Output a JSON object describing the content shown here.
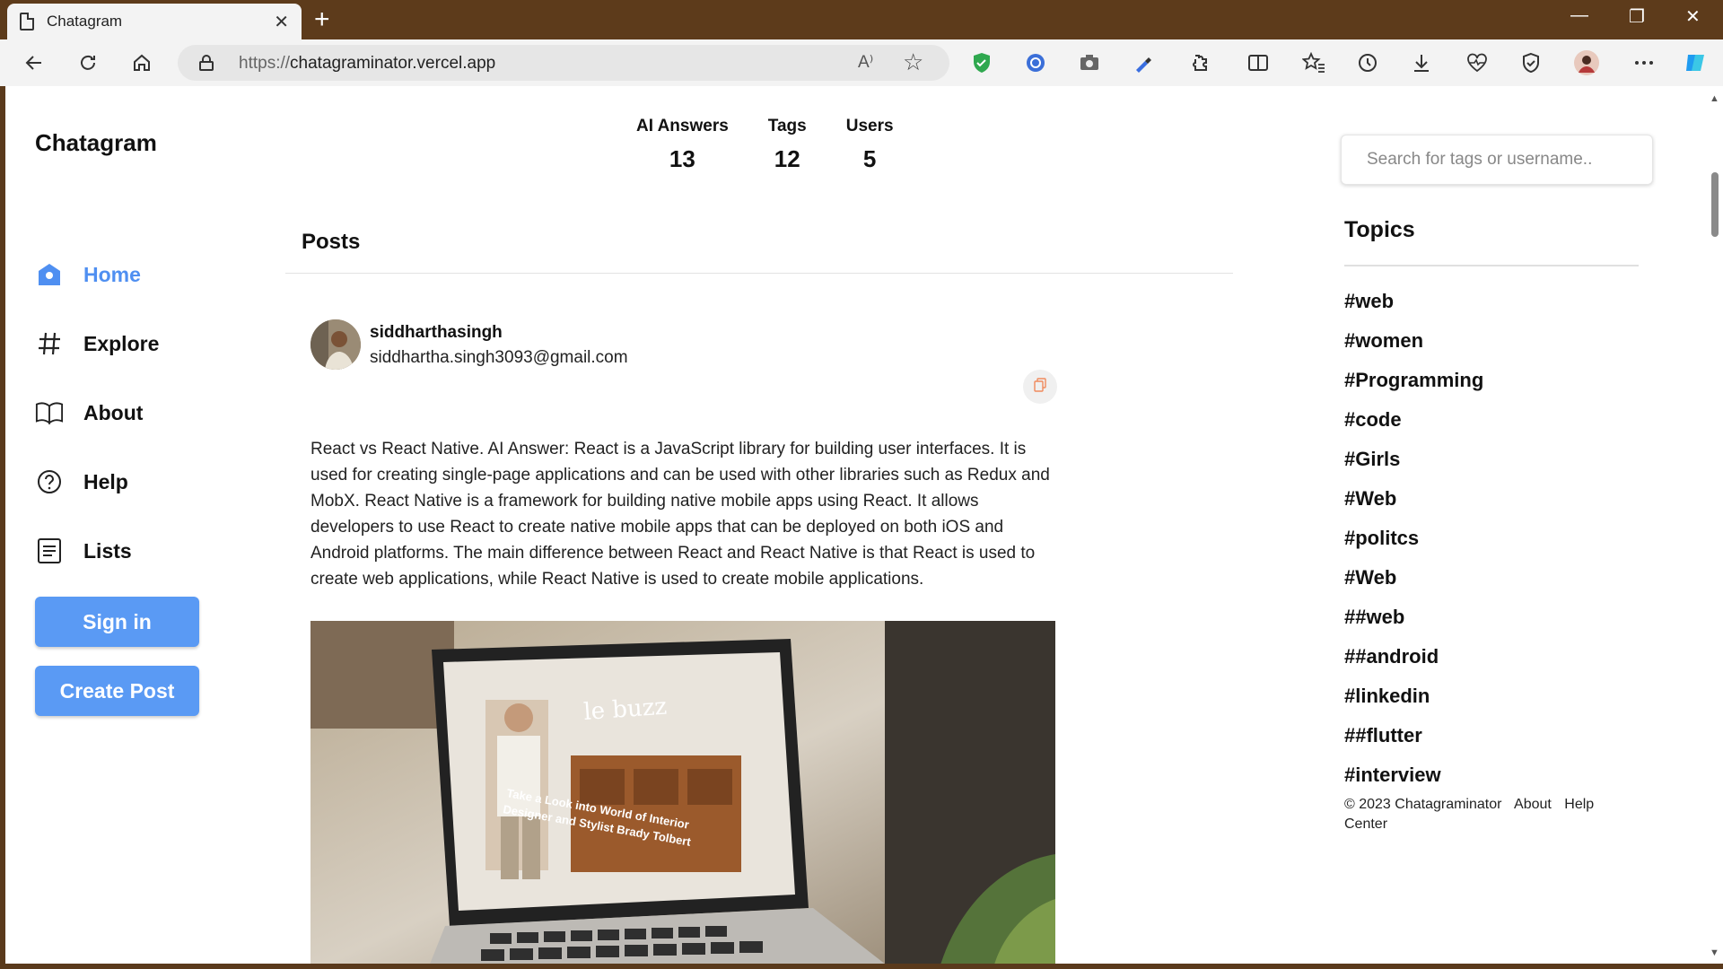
{
  "browser": {
    "tab_title": "Chatagram",
    "tab_close": "✕",
    "new_tab": "+",
    "url_protocol": "https://",
    "url_host": "chatagraminator.vercel.app",
    "read_aloud": "A⁾",
    "win_min": "—",
    "win_restore": "❐",
    "win_close": "✕"
  },
  "app": {
    "brand": "Chatagram"
  },
  "nav": [
    {
      "label": "Home",
      "icon": "home-icon",
      "active": true
    },
    {
      "label": "Explore",
      "icon": "hash-icon",
      "active": false
    },
    {
      "label": "About",
      "icon": "book-icon",
      "active": false
    },
    {
      "label": "Help",
      "icon": "help-circle-icon",
      "active": false
    },
    {
      "label": "Lists",
      "icon": "list-icon",
      "active": false
    }
  ],
  "buttons": {
    "sign_in": "Sign in",
    "create_post": "Create Post"
  },
  "stats": [
    {
      "label": "AI Answers",
      "value": "13"
    },
    {
      "label": "Tags",
      "value": "12"
    },
    {
      "label": "Users",
      "value": "5"
    }
  ],
  "feed": {
    "title": "Posts"
  },
  "post": {
    "username": "siddharthasingh",
    "email": "siddhartha.singh3093@gmail.com",
    "body": "React vs React Native. AI Answer: React is a JavaScript library for building user interfaces. It is used for creating single-page applications and can be used with other libraries such as Redux and MobX. React Native is a framework for building native mobile apps using React. It allows developers to use React to create native mobile apps that can be deployed on both iOS and Android platforms. The main difference between React and React Native is that React is used to create web applications, while React Native is used to create mobile applications.",
    "image_text_line1": "Take a Look into World of Interior",
    "image_text_line2": "Designer and Stylist Brady Tolbert",
    "image_sign": "le buzz"
  },
  "search": {
    "placeholder": "Search for tags or username.."
  },
  "topics": {
    "title": "Topics",
    "items": [
      "#web",
      "#women",
      "#Programming",
      "#code",
      "#Girls",
      "#Web",
      "#politcs",
      "#Web",
      "##web",
      "##android",
      "#linkedin",
      "##flutter",
      "#interview"
    ]
  },
  "footer": {
    "copyright": "© 2023 Chatagraminator",
    "about": "About",
    "help_center": "Help Center"
  },
  "colors": {
    "accent": "#5a9af4",
    "active_nav": "#4f8ff1",
    "chrome": "#5d3b1b"
  }
}
